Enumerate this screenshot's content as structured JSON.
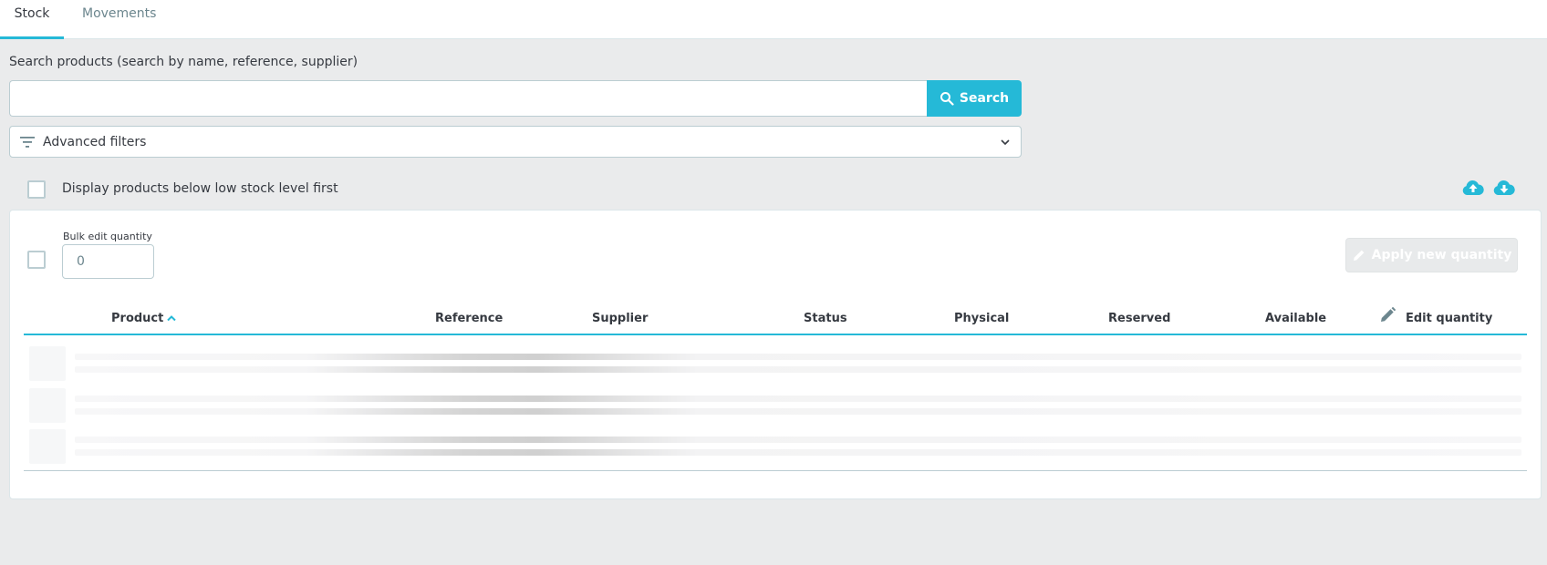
{
  "tabs": [
    {
      "label": "Stock",
      "active": true
    },
    {
      "label": "Movements",
      "active": false
    }
  ],
  "search": {
    "label": "Search products (search by name, reference, supplier)",
    "value": "",
    "placeholder": "",
    "button_label": "Search"
  },
  "advanced_filters": {
    "label": "Advanced filters"
  },
  "low_stock": {
    "label": "Display products below low stock level first",
    "checked": false
  },
  "bulk_edit": {
    "label": "Bulk edit quantity",
    "value": "0",
    "apply_label": "Apply new quantity"
  },
  "table": {
    "columns": [
      "Product",
      "Reference",
      "Supplier",
      "Status",
      "Physical",
      "Reserved",
      "Available",
      "Edit quantity"
    ],
    "sort": {
      "column": "Product",
      "direction": "asc"
    },
    "loading_rows": 3
  },
  "colors": {
    "accent": "#25b9d7",
    "background": "#eaebec",
    "text": "#363a41",
    "border": "#bbcdd2"
  },
  "icons": {
    "search_button": "search-icon",
    "filter": "filter-icon",
    "dropdown": "chevron-down-icon",
    "import": "cloud-upload-icon",
    "export": "cloud-download-icon",
    "sort": "sort-ascending-icon",
    "edit": "pencil-icon"
  }
}
